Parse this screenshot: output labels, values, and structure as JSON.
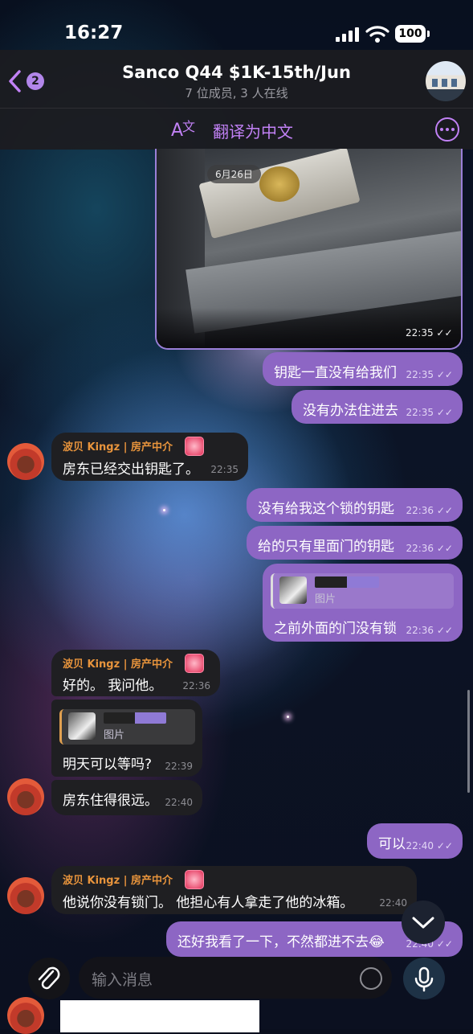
{
  "status": {
    "time": "16:27",
    "battery": "100"
  },
  "header": {
    "back_count": "2",
    "title": "Sanco Q44 $1K-15th/Jun",
    "subtitle": "7 位成员, 3 人在线"
  },
  "translate": {
    "icon": "translate-icon",
    "label": "翻译为中文"
  },
  "photo_message": {
    "date_badge": "6月26日",
    "time": "22:35"
  },
  "messages": {
    "m1": {
      "text": "钥匙一直没有给我们",
      "time": "22:35"
    },
    "m2": {
      "text": "没有办法住进去",
      "time": "22:35"
    },
    "m3": {
      "sender": "波贝 Kingz | 房产中介",
      "text": "房东已经交出钥匙了。",
      "time": "22:35"
    },
    "m4": {
      "text": "没有给我这个锁的钥匙",
      "time": "22:36"
    },
    "m5": {
      "text": "给的只有里面门的钥匙",
      "time": "22:36"
    },
    "m6": {
      "reply_label": "图片",
      "text": "之前外面的门没有锁",
      "time": "22:36"
    },
    "m7": {
      "sender": "波贝 Kingz | 房产中介",
      "text": "好的。 我问他。",
      "time": "22:36"
    },
    "m8": {
      "reply_label": "图片",
      "text": "明天可以等吗?",
      "time": "22:39"
    },
    "m9": {
      "text": "房东住得很远。",
      "time": "22:40"
    },
    "m10": {
      "text": "可以",
      "time": "22:40"
    },
    "m11": {
      "sender": "波贝 Kingz | 房产中介",
      "text": "他说你没有锁门。 他担心有人拿走了他的冰箱。",
      "time": "22:40"
    },
    "m12": {
      "text": "还好我看了一下，不然都进不去😂",
      "time": "22:40"
    }
  },
  "composer": {
    "placeholder": "输入消息"
  },
  "colors": {
    "accent": "#c181f5",
    "outgoing": "#8d66c4",
    "incoming": "#1f1f22",
    "sender_name": "#e8943c"
  }
}
